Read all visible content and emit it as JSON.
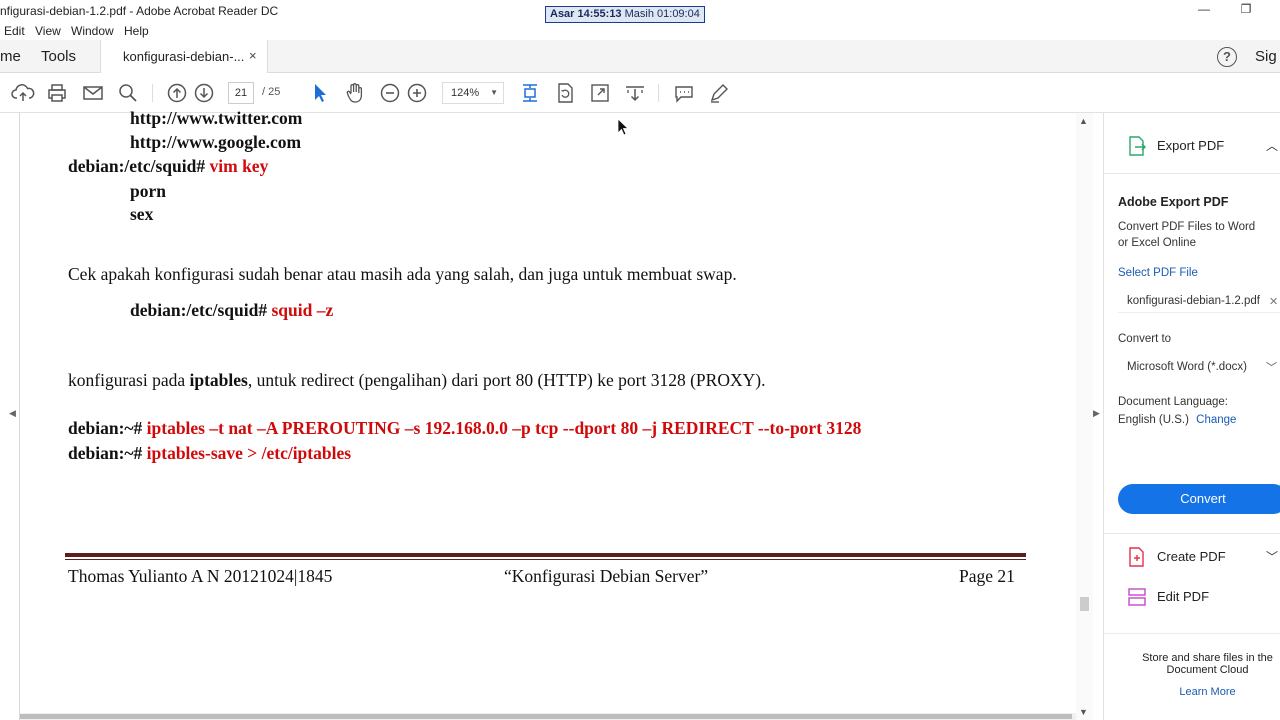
{
  "window": {
    "title": "nfigurasi-debian-1.2.pdf - Adobe Acrobat Reader DC",
    "prayer_label": "Asar 14:55:13",
    "prayer_remaining": "Masih 01:09:04",
    "minimize": "—",
    "restore": "❐"
  },
  "menu": {
    "items": [
      "Edit",
      "View",
      "Window",
      "Help"
    ]
  },
  "tabs": {
    "home": "me",
    "tools": "Tools",
    "document": "konfigurasi-debian-...",
    "close": "×",
    "help": "?",
    "sign": "Sig"
  },
  "toolbar": {
    "current_page": "21",
    "page_sep": "/  25",
    "zoom": "124%",
    "zoom_dd": "▼"
  },
  "document": {
    "lines": {
      "l1": "http://www.twitter.com",
      "l2": "http://www.google.com",
      "l3_prompt": "debian:/etc/squid# ",
      "l3_cmd": "vim key",
      "l4": "porn",
      "l5": "sex",
      "p1": "Cek apakah konfigurasi sudah benar atau masih ada yang salah, dan juga untuk membuat swap.",
      "l6_prompt": "debian:/etc/squid# ",
      "l6_cmd": "squid –z",
      "p2_a": "konfigurasi pada ",
      "p2_b": "iptables",
      "p2_c": ", untuk redirect (pengalihan) dari port 80 (HTTP) ke port 3128 (PROXY).",
      "l7_prompt": "debian:~# ",
      "l7_cmd": "iptables –t nat –A PREROUTING –s 192.168.0.0 –p tcp --dport 80 –j REDIRECT --to-port 3128",
      "l8_prompt": "debian:~# ",
      "l8_cmd": "iptables-save > /etc/iptables"
    },
    "footer": {
      "author": "Thomas Yulianto A N 20121024|1845",
      "title": "“Konfigurasi Debian Server”",
      "page": "Page 21"
    }
  },
  "right_panel": {
    "export_pdf": "Export PDF",
    "adobe_export": "Adobe Export PDF",
    "desc1": "Convert PDF Files to Word",
    "desc2": "or Excel Online",
    "select_pdf": "Select PDF File",
    "file_name": "konfigurasi-debian-1.2.pdf",
    "file_close": "✕",
    "convert_to": "Convert to",
    "format": "Microsoft Word (*.docx)",
    "doc_lang": "Document Language:",
    "lang": "English (U.S.)",
    "change": "Change",
    "convert_btn": "Convert",
    "create_pdf": "Create PDF",
    "edit_pdf": "Edit PDF",
    "store1": "Store and share files in the",
    "store2": "Document Cloud",
    "learn_more": "Learn More"
  },
  "colors": {
    "accent": "#1473e6",
    "code_red": "#d00a0a",
    "code_blue": "#1d2f9c",
    "rule": "#5a1f1f"
  }
}
